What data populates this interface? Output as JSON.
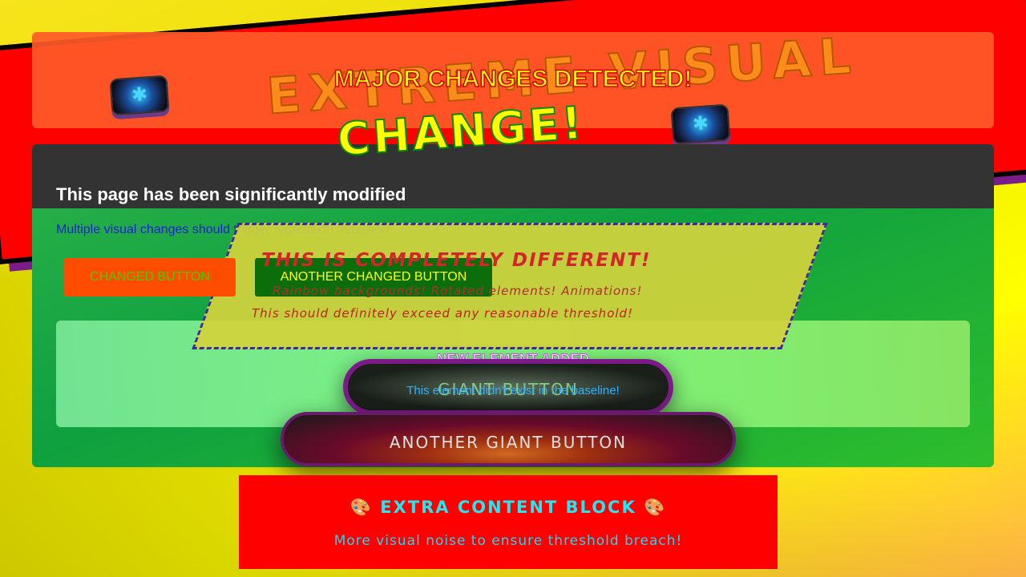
{
  "banner": {
    "line1": "EXTREME VISUAL",
    "line2": "CHANGE!",
    "disk_glyph": "✱",
    "disk_icon": "floppy-disk-icon"
  },
  "header": {
    "title": "MAJOR CHANGES DETECTED!"
  },
  "main": {
    "title": "This page has been significantly modified",
    "subtitle": "Multiple visual changes should trigger regression detection.",
    "buttons": {
      "changed_label": "CHANGED BUTTON",
      "another_label": "ANOTHER CHANGED BUTTON"
    }
  },
  "skew_panel": {
    "line1": "THIS IS COMPLETELY DIFFERENT!",
    "line2": "Rainbow backgrounds! Rotated elements! Animations!",
    "line3": "This should definitely exceed any reasonable threshold!"
  },
  "new_element": {
    "title": "NEW ELEMENT ADDED",
    "subtitle": "This element didn't exist in the baseline!"
  },
  "giant_buttons": {
    "first_label": "GIANT BUTTON",
    "second_label": "ANOTHER GIANT BUTTON"
  },
  "extra_block": {
    "title": "🎨 EXTRA CONTENT BLOCK 🎨",
    "subtitle": "More visual noise to ensure threshold breach!"
  },
  "colors": {
    "banner_red": "#ff0000",
    "header_orange": "#ff5a28",
    "panel_green": "#0fa040",
    "extra_red": "#ff0000",
    "accent_yellow": "#ffff00"
  }
}
